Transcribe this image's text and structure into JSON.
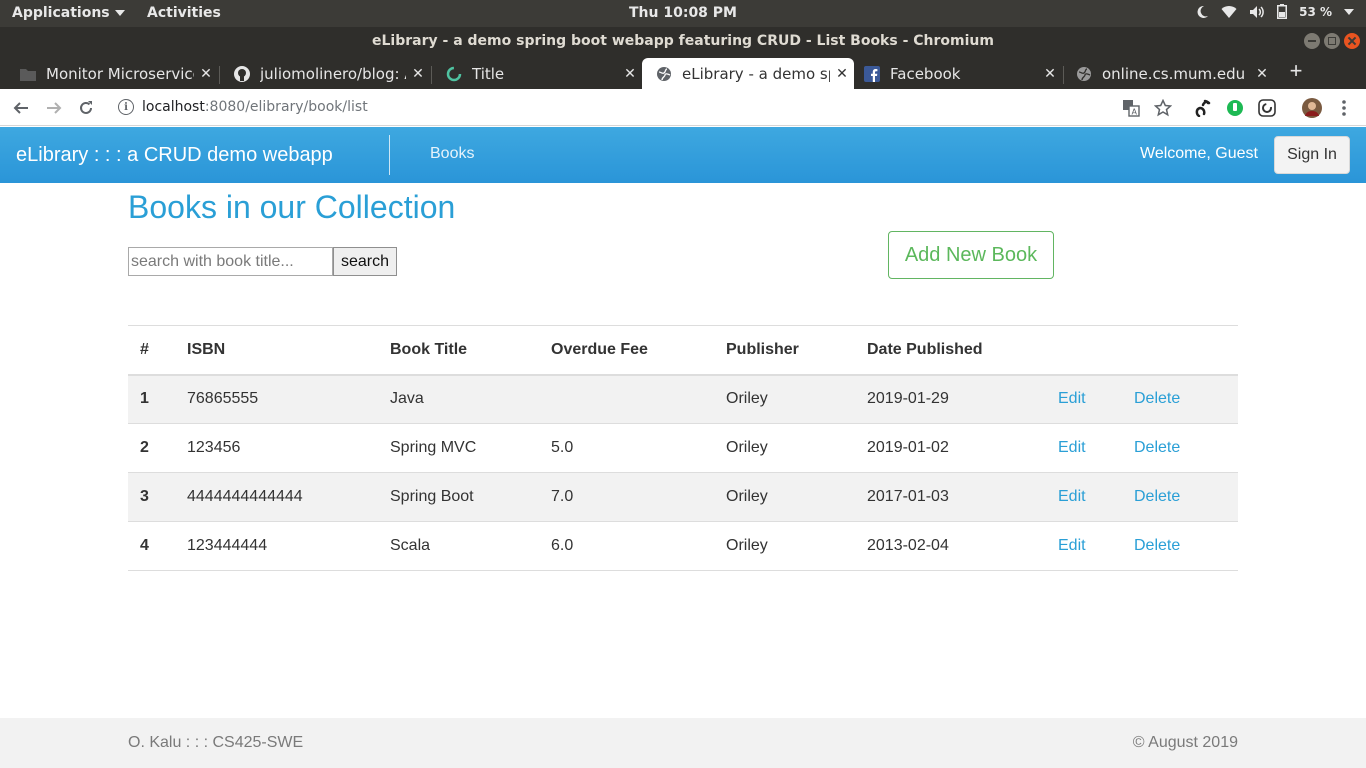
{
  "system_bar": {
    "applications": "Applications",
    "activities": "Activities",
    "clock": "Thu 10:08 PM",
    "battery": "53 %"
  },
  "window": {
    "title": "eLibrary - a demo spring boot webapp featuring CRUD - List Books - Chromium"
  },
  "tabs": [
    {
      "label": "Monitor Microservices",
      "active": false,
      "icon": "folder-icon"
    },
    {
      "label": "juliomolinero/blog: A",
      "active": false,
      "icon": "github-icon"
    },
    {
      "label": "Title",
      "active": false,
      "icon": "loading-icon"
    },
    {
      "label": "eLibrary - a demo spring",
      "active": true,
      "icon": "globe-icon"
    },
    {
      "label": "Facebook",
      "active": false,
      "icon": "facebook-icon"
    },
    {
      "label": "online.cs.mum.edu",
      "active": false,
      "icon": "globe-icon"
    }
  ],
  "address_bar": {
    "host": "localhost",
    "path": ":8080/elibrary/book/list"
  },
  "navbar": {
    "brand": "eLibrary : : : a CRUD demo webapp",
    "books_link": "Books",
    "welcome": "Welcome, Guest",
    "sign_in": "Sign In"
  },
  "main": {
    "heading": "Books in our Collection",
    "search_placeholder": "search with book title...",
    "search_button": "search",
    "add_button": "Add New Book"
  },
  "table": {
    "headers": [
      "#",
      "ISBN",
      "Book Title",
      "Overdue Fee",
      "Publisher",
      "Date Published"
    ],
    "rows": [
      {
        "num": "1",
        "isbn": "76865555",
        "title": "Java",
        "fee": "",
        "publisher": "Oriley",
        "date": "2019-01-29",
        "edit": "Edit",
        "delete": "Delete"
      },
      {
        "num": "2",
        "isbn": "123456",
        "title": "Spring MVC",
        "fee": "5.0",
        "publisher": "Oriley",
        "date": "2019-01-02",
        "edit": "Edit",
        "delete": "Delete"
      },
      {
        "num": "3",
        "isbn": "4444444444444",
        "title": "Spring Boot",
        "fee": "7.0",
        "publisher": "Oriley",
        "date": "2017-01-03",
        "edit": "Edit",
        "delete": "Delete"
      },
      {
        "num": "4",
        "isbn": "123444444",
        "title": "Scala",
        "fee": "6.0",
        "publisher": "Oriley",
        "date": "2013-02-04",
        "edit": "Edit",
        "delete": "Delete"
      }
    ]
  },
  "footer": {
    "left": "O. Kalu : : : CS425-SWE",
    "right": "© August 2019"
  },
  "colors": {
    "navbar": "#2a9fd6",
    "heading": "#2a9fd6",
    "add_button": "#5cb85c",
    "stripe": "#f2f2f2"
  }
}
